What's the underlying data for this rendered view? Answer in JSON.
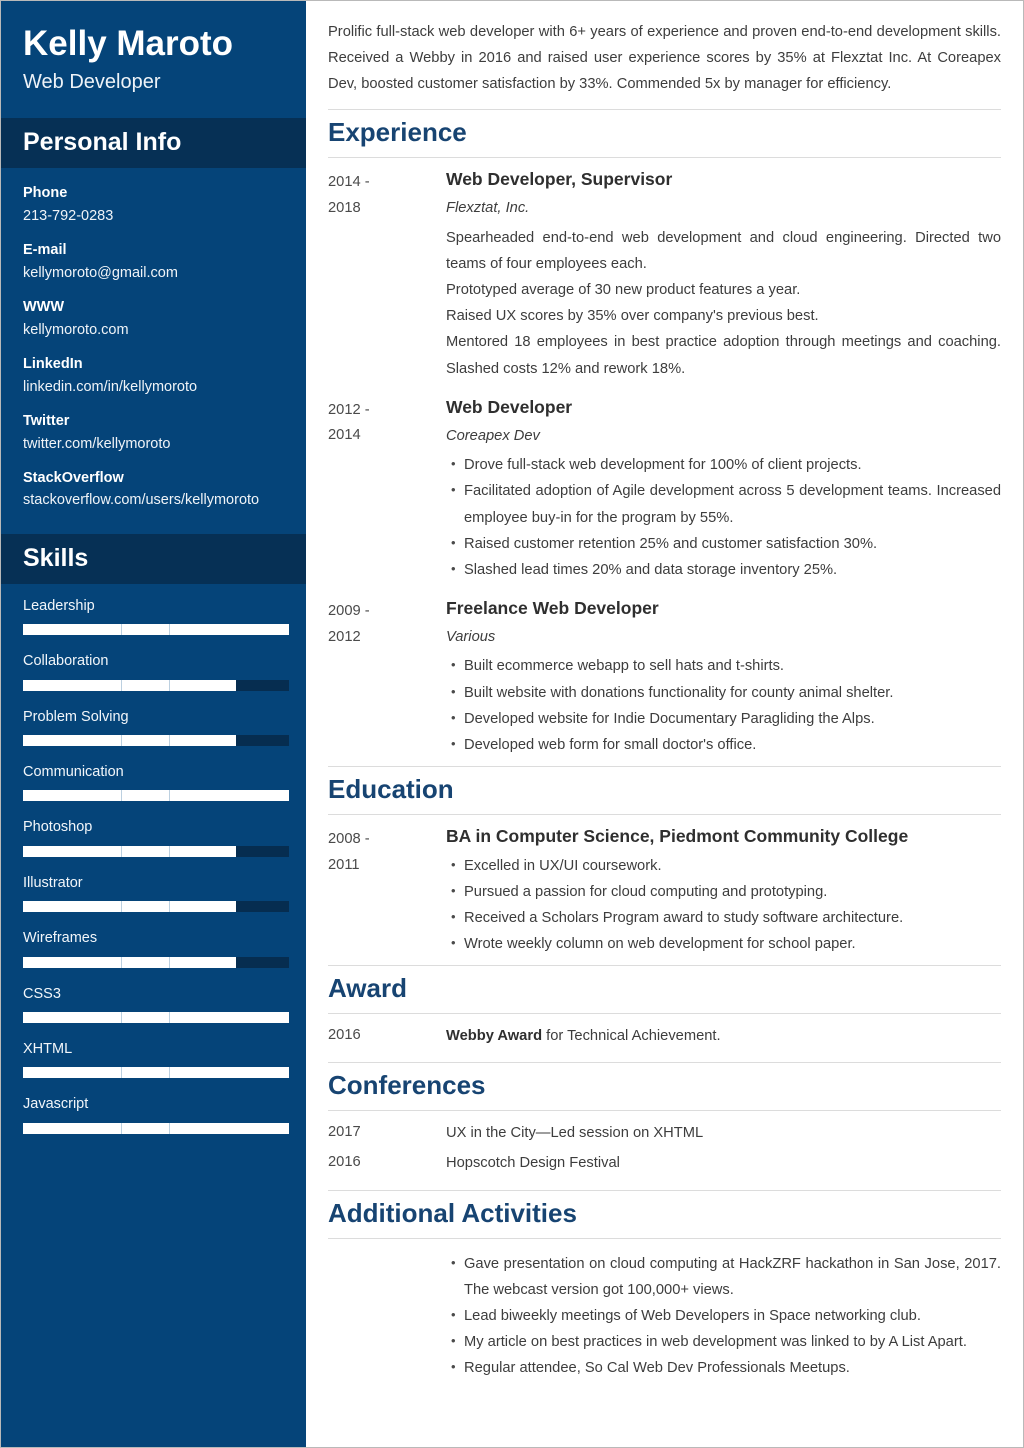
{
  "colors": {
    "sidebar_bg": "#054479",
    "sidebar_band": "#063055",
    "heading_blue": "#174472",
    "bar_track": "#062d50",
    "bar_fill": "#ffffff"
  },
  "sidebar": {
    "full_name": "Kelly Maroto",
    "job_title": "Web Developer",
    "personal_info_heading": "Personal Info",
    "contacts": [
      {
        "label": "Phone",
        "value": "213-792-0283"
      },
      {
        "label": "E-mail",
        "value": "kellymoroto@gmail.com"
      },
      {
        "label": "WWW",
        "value": "kellymoroto.com"
      },
      {
        "label": "LinkedIn",
        "value": "linkedin.com/in/kellymoroto"
      },
      {
        "label": "Twitter",
        "value": "twitter.com/kellymoroto"
      },
      {
        "label": "StackOverflow",
        "value": "stackoverflow.com/users/kellymoroto"
      }
    ],
    "skills_heading": "Skills",
    "skills": [
      {
        "name": "Leadership",
        "level": 100
      },
      {
        "name": "Collaboration",
        "level": 80
      },
      {
        "name": "Problem Solving",
        "level": 80
      },
      {
        "name": "Communication",
        "level": 100
      },
      {
        "name": "Photoshop",
        "level": 80
      },
      {
        "name": "Illustrator",
        "level": 80
      },
      {
        "name": "Wireframes",
        "level": 80
      },
      {
        "name": "CSS3",
        "level": 100
      },
      {
        "name": "XHTML",
        "level": 100
      },
      {
        "name": "Javascript",
        "level": 100
      }
    ]
  },
  "main": {
    "summary": "Prolific full-stack web developer with 6+ years of experience and proven end-to-end development skills. Received a Webby in 2016 and raised user experience scores by 35% at Flexztat Inc. At Coreapex Dev, boosted customer satisfaction by 33%. Commended 5x by manager for efficiency.",
    "experience": {
      "heading": "Experience",
      "entries": [
        {
          "date_start": "2014 -",
          "date_end": "2018",
          "title": "Web Developer, Supervisor",
          "org": "Flexztat, Inc.",
          "style": "lines",
          "items": [
            "Spearheaded end-to-end web development and cloud engineering. Directed two teams of four employees each.",
            "Prototyped average of 30 new product features a year.",
            "Raised UX scores by 35% over company's previous best.",
            "Mentored 18 employees in best practice adoption through meetings and coaching. Slashed costs 12% and rework 18%."
          ]
        },
        {
          "date_start": "2012 -",
          "date_end": "2014",
          "title": "Web Developer",
          "org": "Coreapex Dev",
          "style": "bullets",
          "items": [
            "Drove full-stack web development for 100% of client projects.",
            "Facilitated adoption of Agile development across 5 development teams. Increased employee buy-in for the program by 55%.",
            "Raised customer retention 25% and customer satisfaction 30%.",
            "Slashed lead times 20% and data storage inventory 25%."
          ]
        },
        {
          "date_start": "2009 -",
          "date_end": "2012",
          "title": "Freelance Web Developer",
          "org": "Various",
          "style": "bullets",
          "items": [
            "Built ecommerce webapp to sell hats and t-shirts.",
            "Built website with donations functionality for county animal shelter.",
            "Developed website for Indie Documentary Paragliding the Alps.",
            "Developed web form for small doctor's office."
          ]
        }
      ]
    },
    "education": {
      "heading": "Education",
      "entries": [
        {
          "date_start": "2008 -",
          "date_end": "2011",
          "title": "BA in Computer Science, Piedmont Community College",
          "org": "",
          "style": "bullets",
          "items": [
            "Excelled in UX/UI coursework.",
            "Pursued a passion for cloud computing and prototyping.",
            "Received a Scholars Program award to study software architecture.",
            "Wrote weekly column on web development for school paper."
          ]
        }
      ]
    },
    "award": {
      "heading": "Award",
      "rows": [
        {
          "date": "2016",
          "bold": "Webby Award",
          "rest": " for Technical Achievement."
        }
      ]
    },
    "conferences": {
      "heading": "Conferences",
      "rows": [
        {
          "date": "2017",
          "bold": "",
          "rest": "UX in the City—Led session on XHTML"
        },
        {
          "date": "2016",
          "bold": "",
          "rest": "Hopscotch Design Festival"
        }
      ]
    },
    "additional_activities": {
      "heading": "Additional Activities",
      "items": [
        "Gave presentation on cloud computing at HackZRF hackathon in San Jose, 2017. The webcast version got 100,000+ views.",
        "Lead biweekly meetings of Web Developers in Space networking club.",
        "My article on best practices in web development was linked to by A List Apart.",
        "Regular attendee, So Cal Web Dev Professionals Meetups."
      ]
    }
  }
}
